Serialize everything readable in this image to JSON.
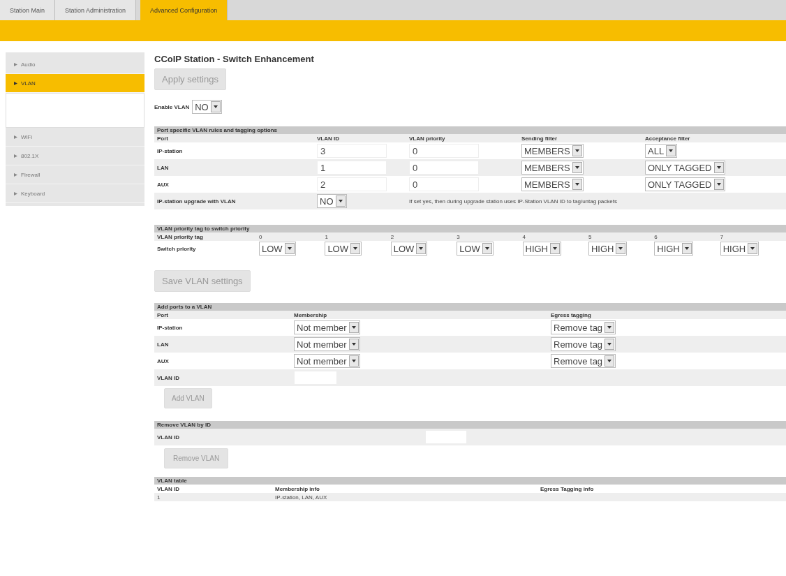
{
  "tabs": [
    {
      "label": "Station Main",
      "selected": false
    },
    {
      "label": "Station Administration",
      "selected": false
    },
    {
      "label": "Advanced Configuration",
      "selected": true
    }
  ],
  "sidebar": {
    "items": [
      {
        "label": "Audio",
        "selected": false
      },
      {
        "label": "VLAN",
        "selected": true
      },
      {
        "label": "WiFi",
        "selected": false
      },
      {
        "label": "802.1X",
        "selected": false
      },
      {
        "label": "Firewall",
        "selected": false
      },
      {
        "label": "Keyboard",
        "selected": false
      }
    ]
  },
  "page_title": "CCoIP Station - Switch Enhancement",
  "apply_button": "Apply settings",
  "enable_vlan": {
    "label": "Enable VLAN",
    "value": "NO"
  },
  "port_rules": {
    "title": "Port specific VLAN rules and tagging options",
    "columns": [
      "Port",
      "VLAN ID",
      "VLAN priority",
      "Sending filter",
      "Acceptance filter"
    ],
    "rows": [
      {
        "port": "IP-station",
        "vlan_id": "3",
        "priority": "0",
        "sending": "MEMBERS",
        "acceptance": "ALL"
      },
      {
        "port": "LAN",
        "vlan_id": "1",
        "priority": "0",
        "sending": "MEMBERS",
        "acceptance": "ONLY TAGGED"
      },
      {
        "port": "AUX",
        "vlan_id": "2",
        "priority": "0",
        "sending": "MEMBERS",
        "acceptance": "ONLY TAGGED"
      }
    ],
    "upgrade": {
      "label": "IP-station upgrade with VLAN",
      "value": "NO",
      "note": "If set yes, then during upgrade station uses IP-Station VLAN ID to tag/untag packets"
    }
  },
  "priority_map": {
    "title": "VLAN priority tag to switch priority",
    "tag_label": "VLAN priority tag",
    "switch_label": "Switch priority",
    "tags": [
      "0",
      "1",
      "2",
      "3",
      "4",
      "5",
      "6",
      "7"
    ],
    "priorities": [
      "LOW",
      "LOW",
      "LOW",
      "LOW",
      "HIGH",
      "HIGH",
      "HIGH",
      "HIGH"
    ]
  },
  "save_button": "Save VLAN settings",
  "add_ports": {
    "title": "Add ports to a VLAN",
    "columns": [
      "Port",
      "Membership",
      "Egress tagging"
    ],
    "rows": [
      {
        "port": "IP-station",
        "membership": "Not member",
        "egress": "Remove tag"
      },
      {
        "port": "LAN",
        "membership": "Not member",
        "egress": "Remove tag"
      },
      {
        "port": "AUX",
        "membership": "Not member",
        "egress": "Remove tag"
      }
    ],
    "vlan_id_label": "VLAN ID",
    "button": "Add VLAN"
  },
  "remove_vlan": {
    "title": "Remove VLAN by ID",
    "vlan_id_label": "VLAN ID",
    "button": "Remove VLAN"
  },
  "vlan_table": {
    "title": "VLAN table",
    "columns": [
      "VLAN ID",
      "Membership info",
      "Egress Tagging info"
    ],
    "rows": [
      [
        "1",
        "IP-station, LAN, AUX"
      ]
    ]
  }
}
